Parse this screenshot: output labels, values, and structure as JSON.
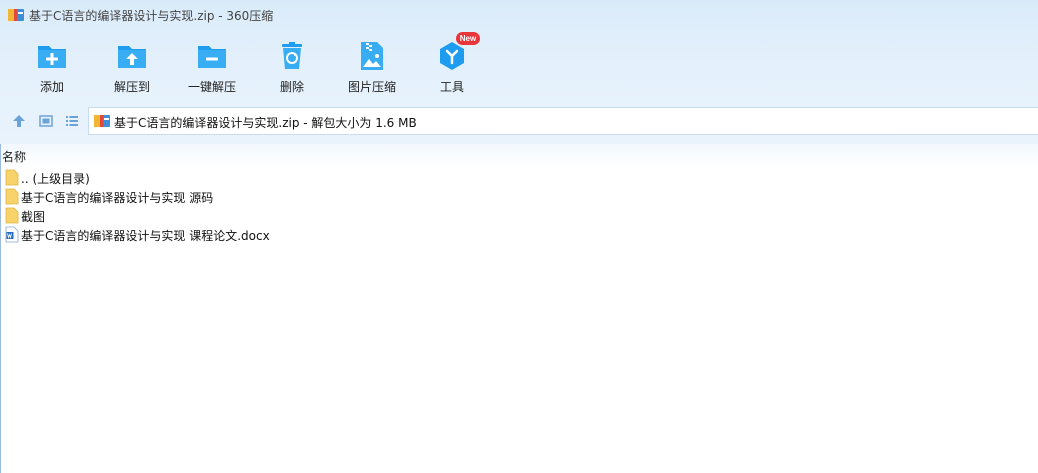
{
  "window": {
    "title": "基于C语言的编译器设计与实现.zip - 360压缩"
  },
  "toolbar": {
    "add": "添加",
    "extract_to": "解压到",
    "one_click_extract": "一键解压",
    "delete": "删除",
    "image_compress": "图片压缩",
    "tools": "工具",
    "tools_badge": "New"
  },
  "address": {
    "path": "基于C语言的编译器设计与实现.zip - 解包大小为 1.6 MB"
  },
  "columns": {
    "name": "名称"
  },
  "files": [
    {
      "name": ".. (上级目录)",
      "icon": "folder-icon"
    },
    {
      "name": "基于C语言的编译器设计与实现 源码",
      "icon": "folder-icon"
    },
    {
      "name": "截图",
      "icon": "folder-icon"
    },
    {
      "name": "基于C语言的编译器设计与实现 课程论文.docx",
      "icon": "word-document-icon"
    }
  ],
  "colors": {
    "accent": "#1e9cf0",
    "toolbar_bg": "#dfeefb",
    "badge": "#e8363a",
    "folder": "#f7d36a"
  }
}
